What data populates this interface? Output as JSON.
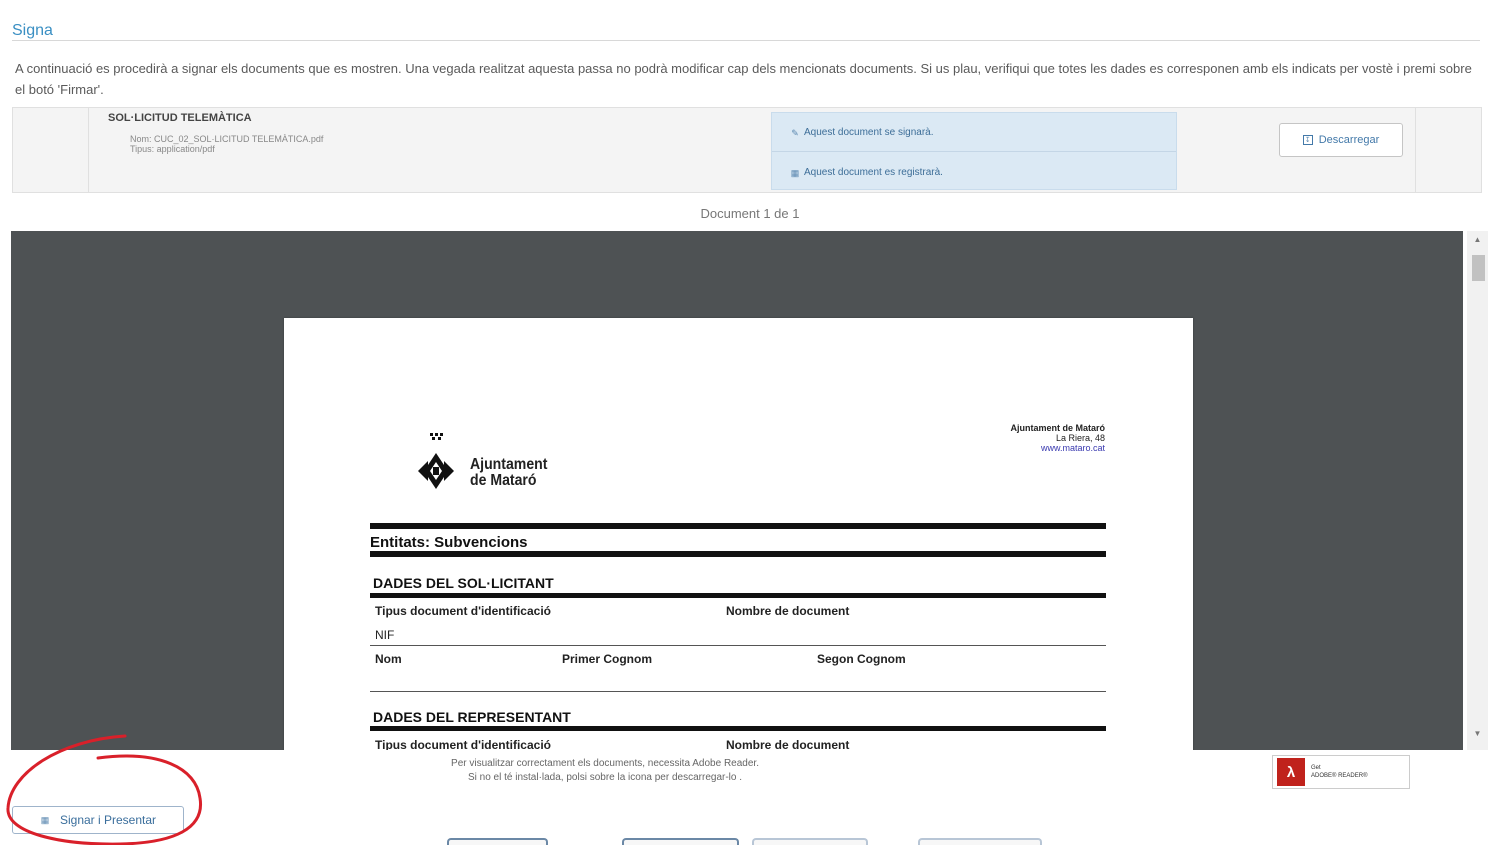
{
  "section": {
    "title": "Signa",
    "intro": "A continuació es procedirà a signar els documents que es mostren. Una vegada realitzat aquesta passa no podrà modificar cap dels mencionats documents. Si us plau, verifiqui que totes les dades es corresponen amb els indicats per vostè i premi sobre el botó 'Firmar'."
  },
  "document": {
    "name": "SOL·LICITUD TELEMÀTICA",
    "filename": "Nom: CUC_02_SOL·LICITUD TELEMÀTICA.pdf",
    "type": "Tipus: application/pdf",
    "status_sign": "Aquest document se signarà.",
    "status_register": "Aquest document es registrarà.",
    "download_label": "Descarregar"
  },
  "pager": {
    "count_text": "Document 1 de 1"
  },
  "pdf": {
    "logo_line1": "Ajuntament",
    "logo_line2": "de Mataró",
    "org_name": "Ajuntament de Mataró",
    "org_address": "La Riera, 48",
    "org_web": "www.mataro.cat",
    "heading": "Entitats: Subvencions",
    "applicant_section": "DADES DEL SOL·LICITANT",
    "label_id_type": "Tipus document d'identificació",
    "label_doc_number": "Nombre de document",
    "value_id_type": "NIF",
    "label_name": "Nom",
    "label_surname1": "Primer Cognom",
    "label_surname2": "Segon Cognom",
    "representative_section": "DADES DEL REPRESENTANT",
    "label_id_type_rep": "Tipus document d'identificació",
    "label_doc_number_rep": "Nombre de document"
  },
  "reader_note": {
    "line1": "Per visualitzar correctament els documents, necessita Adobe Reader.",
    "line2": "Si no el té instal·lada, polsi sobre la icona per descarregar-lo ."
  },
  "adobe": {
    "line1": "Get",
    "line2": "ADOBE® READER®"
  },
  "actions": {
    "sign_submit_label": "Signar i Presentar"
  },
  "colors": {
    "accent": "#3a8fc3",
    "status_bg": "#dbe9f4",
    "viewer_bg": "#4e5254",
    "annotation": "#d9202a"
  }
}
